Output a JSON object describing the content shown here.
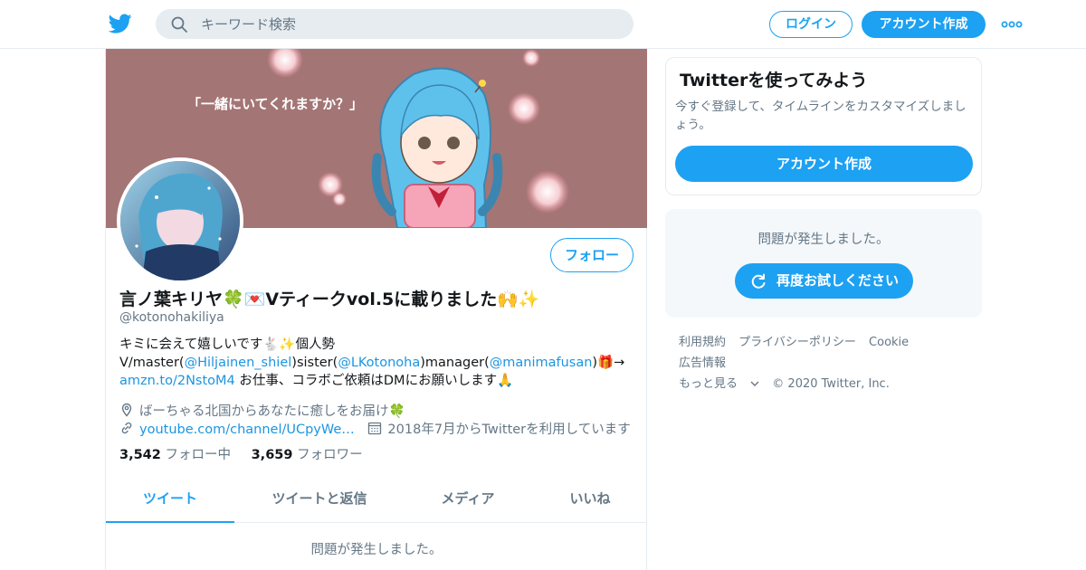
{
  "header": {
    "search_placeholder": "キーワード検索",
    "login_label": "ログイン",
    "signup_label": "アカウント作成",
    "logo_icon": "twitter-bird-icon",
    "more_icon": "more-dots-icon"
  },
  "banner": {
    "speech_text": "「一緒にいてくれますか？」"
  },
  "profile": {
    "follow_label": "フォロー",
    "display_name": "言ノ葉キリヤ🍀💌Vティークvol.5に載りました🙌✨",
    "handle": "@kotonohakiliya",
    "bio": {
      "line1": "キミに会えて嬉しいです🐇✨個人勢",
      "l2_a": "V/master(",
      "l2_m1": "@Hiljainen_shiel",
      "l2_b": ")sister(",
      "l2_m2": "@LKotonoha",
      "l2_c": ")manager(",
      "l2_m3": "@manimafusan",
      "l2_d": ")🎁→",
      "l3_link": "amzn.to/2NstoM4",
      "l3_rest": " お仕事、コラボご依頼はDMにお願いします🙏"
    },
    "location": "ばーちゃる北国からあなたに癒しをお届け🍀",
    "website": "youtube.com/channel/UCpyWe…",
    "joined": "2018年7月からTwitterを利用しています",
    "following_count": "3,542",
    "following_label": "フォロー中",
    "followers_count": "3,659",
    "followers_label": "フォロワー"
  },
  "tabs": [
    "ツイート",
    "ツイートと返信",
    "メディア",
    "いいね"
  ],
  "timeline_error": "問題が発生しました。",
  "sidebar": {
    "cta_title": "Twitterを使ってみよう",
    "cta_desc": "今すぐ登録して、タイムラインをカスタマイズしましょう。",
    "cta_button": "アカウント作成",
    "error_msg": "問題が発生しました。",
    "retry_label": "再度お試しください"
  },
  "footer": {
    "links": [
      "利用規約",
      "プライバシーポリシー",
      "Cookie",
      "広告情報"
    ],
    "more": "もっと見る",
    "copyright": "© 2020 Twitter, Inc."
  },
  "colors": {
    "accent": "#1da1f2",
    "link": "#1b95e0",
    "muted": "#657786",
    "banner_bg": "#a47575"
  }
}
